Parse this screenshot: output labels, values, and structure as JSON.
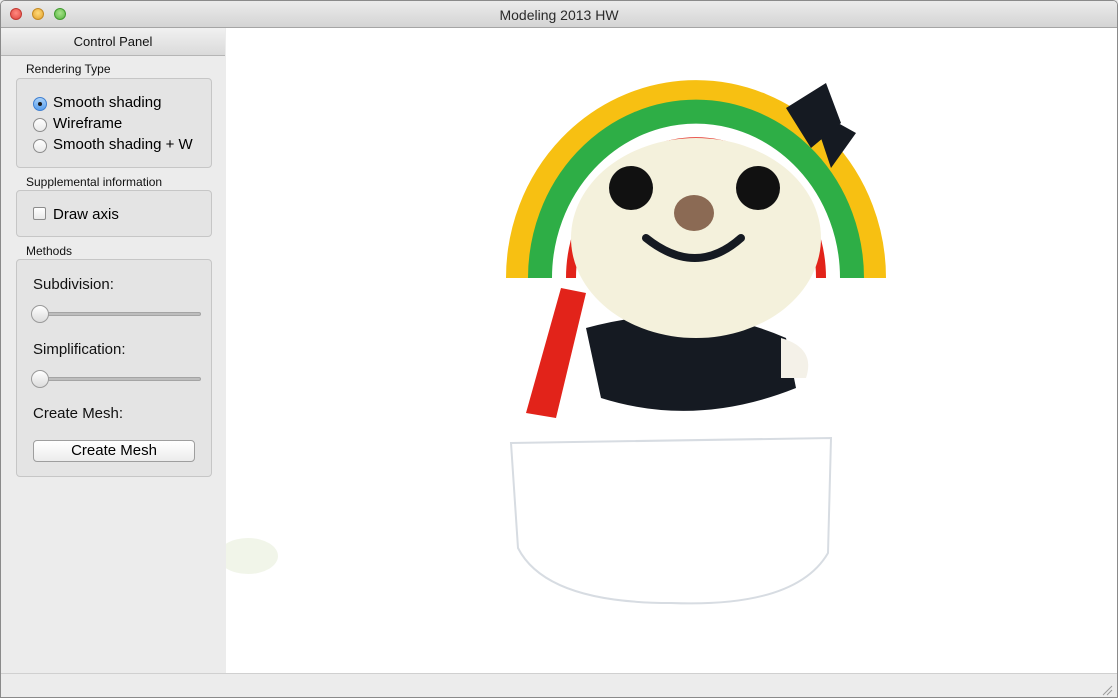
{
  "window": {
    "title": "Modeling 2013 HW"
  },
  "panel": {
    "header": "Control Panel",
    "rendering_type": {
      "title": "Rendering Type",
      "options": [
        "Smooth shading",
        "Wireframe",
        "Smooth shading + W"
      ],
      "selected": "Smooth shading"
    },
    "supplemental": {
      "title": "Supplemental information",
      "draw_axis_label": "Draw axis",
      "draw_axis_checked": false
    },
    "methods": {
      "title": "Methods",
      "subdivision_label": "Subdivision:",
      "subdivision_value": 0,
      "simplification_label": "Simplification:",
      "simplification_value": 0,
      "create_mesh_label": "Create Mesh:",
      "create_mesh_button": "Create Mesh"
    }
  },
  "viewport": {
    "subject": "mascot-model",
    "colors": {
      "background": "#ffffff",
      "red": "#e2231a",
      "green": "#2eae46",
      "yellow": "#f7c012",
      "black": "#151a22"
    }
  },
  "icons": [
    "close-icon",
    "minimize-icon",
    "zoom-icon",
    "resize-grip-icon"
  ]
}
